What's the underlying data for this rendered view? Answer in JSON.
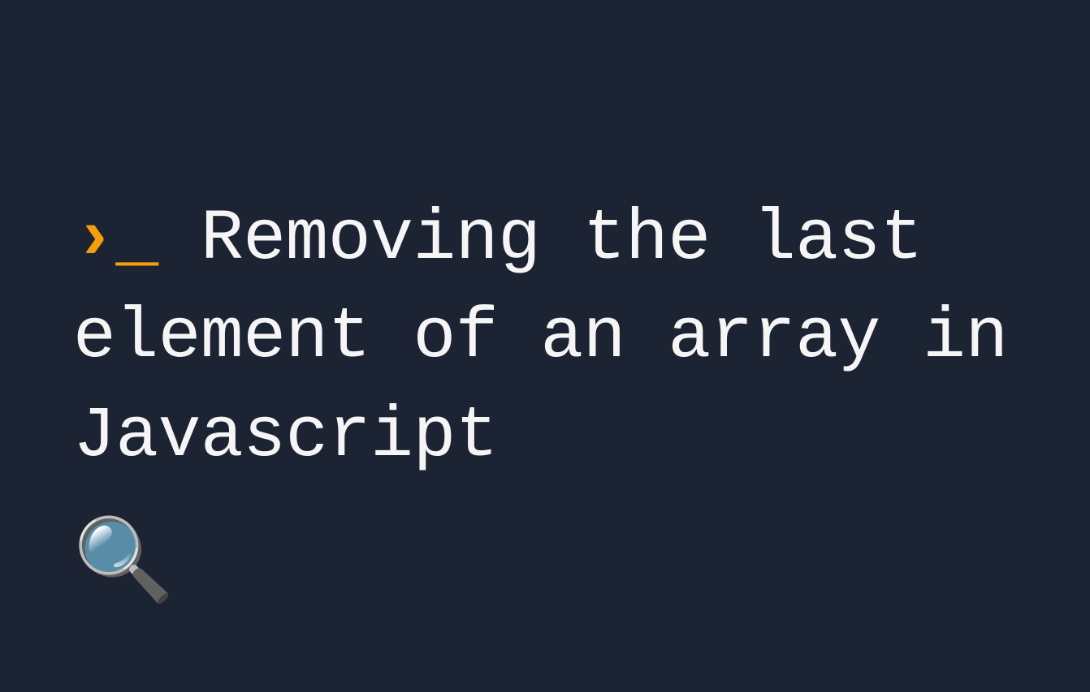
{
  "heading": {
    "prompt_angle": "›",
    "prompt_underscore": "_",
    "title": "Removing the last element of an array in Javascript"
  },
  "icon": {
    "magnifier": "🔍"
  },
  "colors": {
    "background": "#1c2333",
    "accent": "#f59e0b",
    "text": "#f5f5f5"
  }
}
